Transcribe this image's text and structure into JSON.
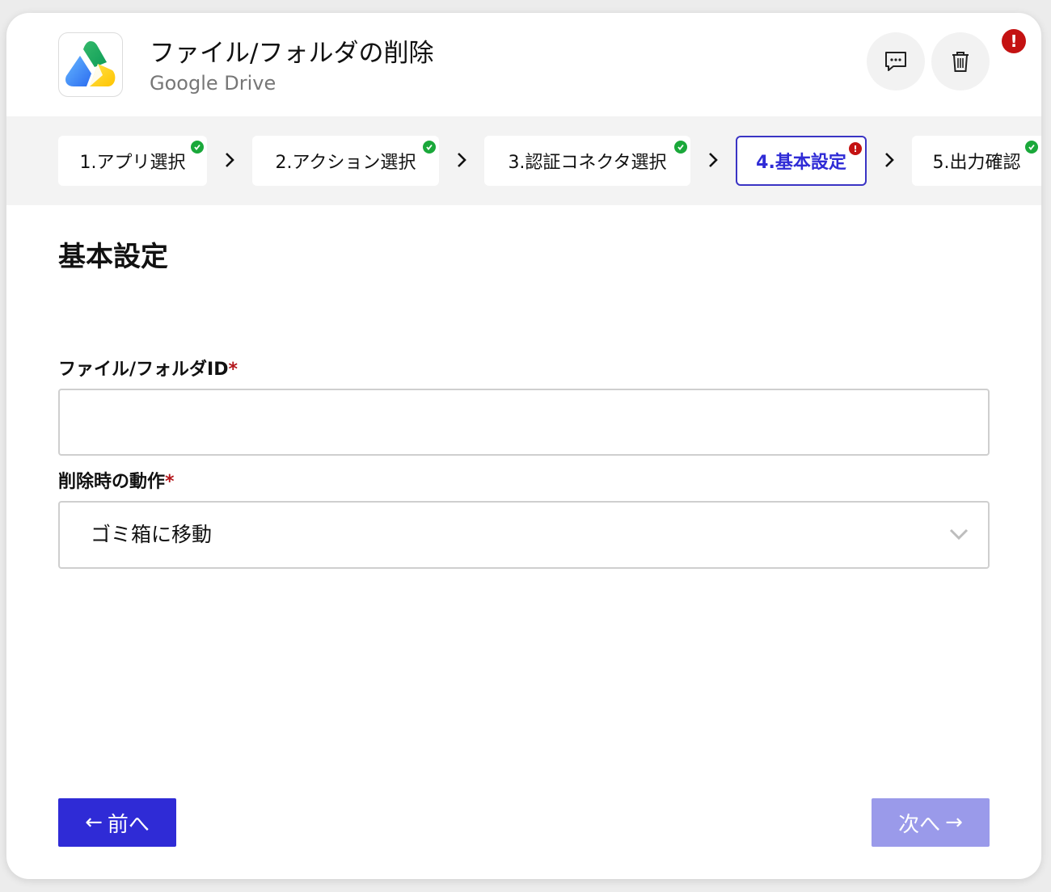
{
  "header": {
    "title": "ファイル/フォルダの削除",
    "subtitle": "Google Drive",
    "app_icon": "google-drive-logo",
    "comment_icon": "comment-icon",
    "trash_icon": "trash-icon",
    "alert_badge": "!"
  },
  "steps": [
    {
      "label": "1.アプリ選択",
      "status": "done"
    },
    {
      "label": "2.アクション選択",
      "status": "done"
    },
    {
      "label": "3.認証コネクタ選択",
      "status": "done"
    },
    {
      "label": "4.基本設定",
      "status": "error",
      "active": true
    },
    {
      "label": "5.出力確認",
      "status": "done"
    }
  ],
  "step_error_mark": "!",
  "main": {
    "section_title": "基本設定",
    "fields": {
      "file_id": {
        "label": "ファイル/フォルダID",
        "required_mark": "*",
        "value": ""
      },
      "delete_action": {
        "label": "削除時の動作",
        "required_mark": "*",
        "selected": "ゴミ箱に移動"
      }
    }
  },
  "footer": {
    "prev_arrow": "←",
    "prev_label": "前へ",
    "next_label": "次へ",
    "next_arrow": "→"
  },
  "colors": {
    "primary": "#2f2bd6",
    "primary_disabled": "#9a9aea",
    "success": "#1aa83a",
    "error": "#c41212"
  }
}
